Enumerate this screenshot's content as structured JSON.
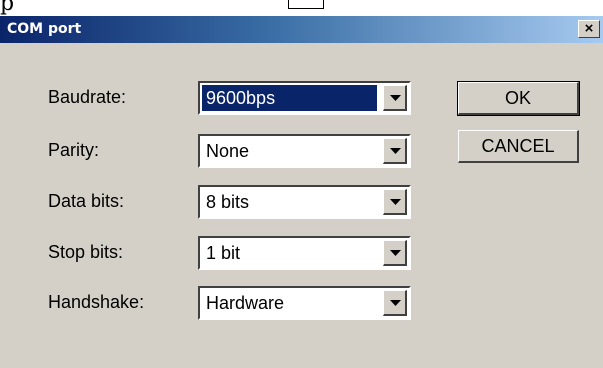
{
  "window": {
    "title": "COM port",
    "close_label": "×"
  },
  "fields": [
    {
      "label": "Baudrate:",
      "value": "9600bps",
      "selected": true
    },
    {
      "label": "Parity:",
      "value": "None",
      "selected": false
    },
    {
      "label": "Data bits:",
      "value": "8 bits",
      "selected": false
    },
    {
      "label": "Stop bits:",
      "value": "1 bit",
      "selected": false
    },
    {
      "label": "Handshake:",
      "value": "Hardware",
      "selected": false
    }
  ],
  "buttons": {
    "ok": "OK",
    "cancel": "CANCEL"
  },
  "icons": {
    "dropdown": "chevron-down-icon",
    "close": "close-icon"
  },
  "colors": {
    "titlebar_start": "#0a246a",
    "titlebar_end": "#a6caf0",
    "selection": "#0a246a",
    "dialog_bg": "#d4d0c8"
  }
}
